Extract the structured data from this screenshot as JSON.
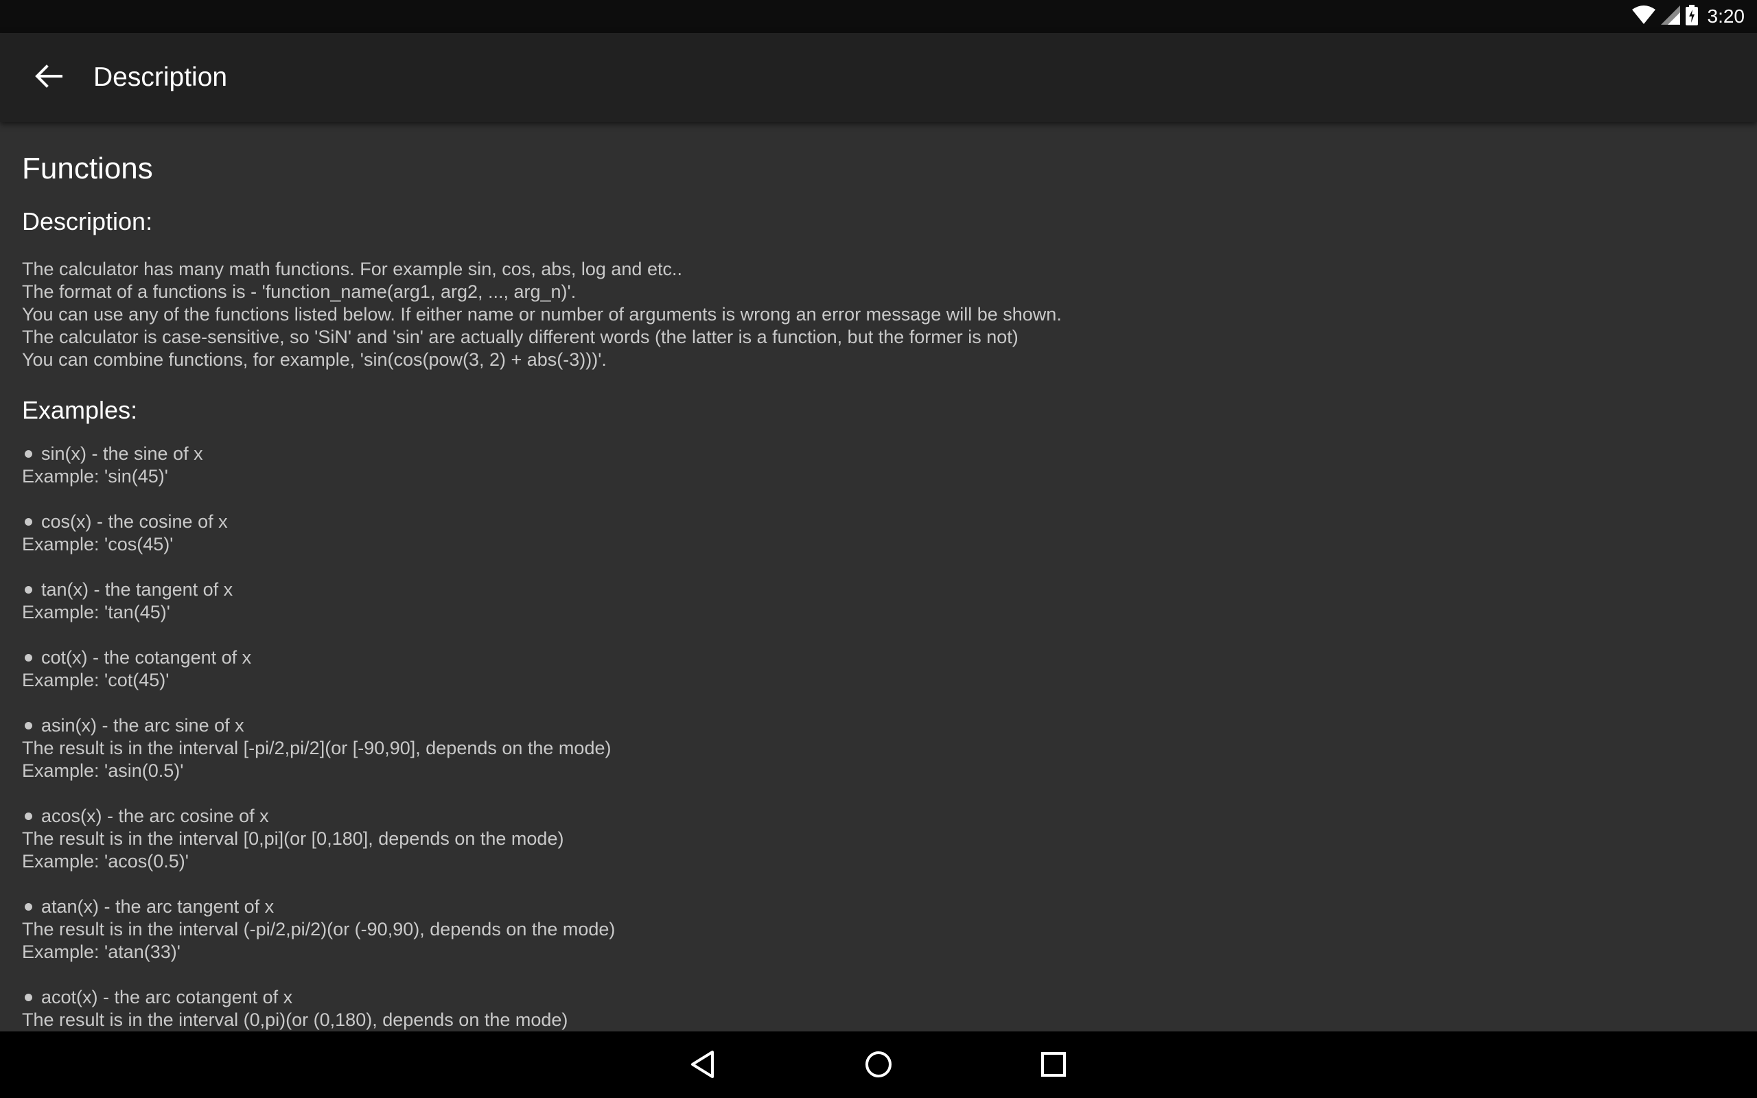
{
  "status_bar": {
    "time": "3:20",
    "icons": [
      "wifi-icon",
      "cell-signal-icon",
      "battery-charging-icon"
    ]
  },
  "app_bar": {
    "back_icon": "arrow-back-icon",
    "title": "Description"
  },
  "content": {
    "heading": "Functions",
    "description_heading": "Description:",
    "description_lines": [
      "The calculator has many math functions. For example sin, cos, abs, log and etc..",
      "The format of a functions is - 'function_name(arg1, arg2, ..., arg_n)'.",
      "You can use any of the functions listed below. If either name or number of arguments is wrong an error message will be shown.",
      "The calculator is case-sensitive, so 'SiN' and 'sin' are actually different words (the latter is a function, but the former is not)",
      "You can combine functions, for example, 'sin(cos(pow(3, 2) + abs(-3)))'."
    ],
    "examples_heading": "Examples:",
    "functions": [
      {
        "title": "sin(x) - the sine of x",
        "lines": [
          "Example: 'sin(45)'"
        ]
      },
      {
        "title": "cos(x) - the cosine of x",
        "lines": [
          "Example: 'cos(45)'"
        ]
      },
      {
        "title": "tan(x) - the tangent of x",
        "lines": [
          "Example: 'tan(45)'"
        ]
      },
      {
        "title": "cot(x) - the cotangent of x",
        "lines": [
          "Example: 'cot(45)'"
        ]
      },
      {
        "title": "asin(x) - the arc sine of x",
        "lines": [
          "The result is in the interval [-pi/2,pi/2](or [-90,90], depends on the mode)",
          "Example: 'asin(0.5)'"
        ]
      },
      {
        "title": "acos(x) - the arc cosine of x",
        "lines": [
          "The result is in the interval [0,pi](or [0,180], depends on the mode)",
          "Example: 'acos(0.5)'"
        ]
      },
      {
        "title": "atan(x) - the arc tangent of x",
        "lines": [
          "The result is in the interval (-pi/2,pi/2)(or (-90,90), depends on the mode)",
          "Example: 'atan(33)'"
        ]
      },
      {
        "title": "acot(x) - the arc cotangent of x",
        "lines": [
          "The result is in the interval (0,pi)(or (0,180), depends on the mode)"
        ]
      }
    ]
  },
  "nav_bar": {
    "buttons": [
      "back-triangle-icon",
      "home-circle-icon",
      "recents-square-icon"
    ]
  },
  "colors": {
    "status_bar_bg": "#0d0d0d",
    "app_bar_bg": "#212121",
    "content_bg": "#303030",
    "nav_bar_bg": "#000000",
    "heading_text": "#ffffff",
    "body_text": "#c9c9c9"
  }
}
